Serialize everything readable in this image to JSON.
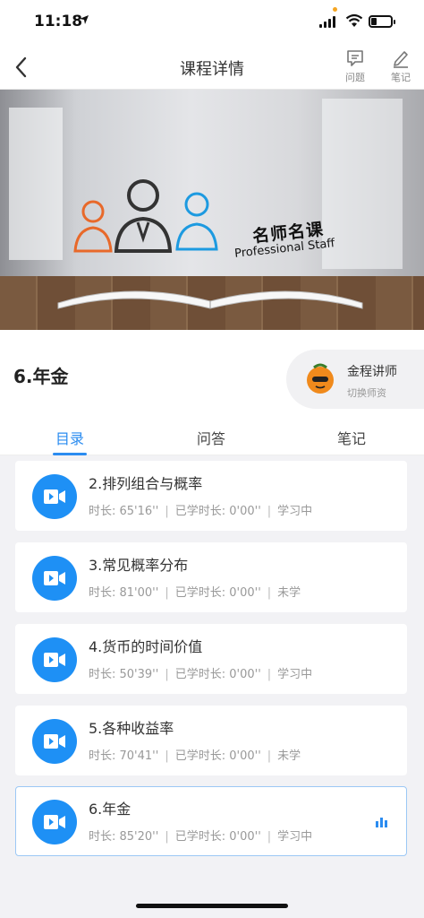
{
  "status_bar": {
    "time": "11:18"
  },
  "nav": {
    "title": "课程详情",
    "question_label": "问题",
    "notes_label": "笔记"
  },
  "banner": {
    "brand": "名师名课",
    "brand_sub": "Professional Staff"
  },
  "course": {
    "name": "6.年金"
  },
  "teacher": {
    "name": "金程讲师",
    "switch_label": "切换师资"
  },
  "tabs": [
    {
      "label": "目录",
      "active": true
    },
    {
      "label": "问答",
      "active": false
    },
    {
      "label": "笔记",
      "active": false
    }
  ],
  "lessons": [
    {
      "title": "2.排列组合与概率",
      "duration": "时长: 65'16''",
      "studied": "已学时长: 0'00''",
      "status": "学习中"
    },
    {
      "title": "3.常见概率分布",
      "duration": "时长: 81'00''",
      "studied": "已学时长: 0'00''",
      "status": "未学"
    },
    {
      "title": "4.货币的时间价值",
      "duration": "时长: 50'39''",
      "studied": "已学时长: 0'00''",
      "status": "学习中"
    },
    {
      "title": "5.各种收益率",
      "duration": "时长: 70'41''",
      "studied": "已学时长: 0'00''",
      "status": "未学"
    },
    {
      "title": "6.年金",
      "duration": "时长: 85'20''",
      "studied": "已学时长: 0'00''",
      "status": "学习中",
      "playing": true
    }
  ],
  "colors": {
    "accent": "#2b8cf0",
    "video_icon": "#1e90f5"
  }
}
